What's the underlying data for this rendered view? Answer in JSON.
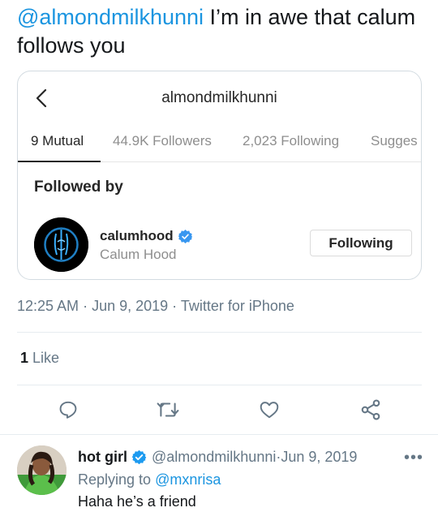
{
  "tweet": {
    "mention": "@almondmilkhunni",
    "text": " I’m in awe that calum follows you"
  },
  "instagram": {
    "username": "almondmilkhunni",
    "tabs": [
      {
        "label": "9 Mutual",
        "active": true
      },
      {
        "label": "44.9K Followers",
        "active": false
      },
      {
        "label": "2,023 Following",
        "active": false
      },
      {
        "label": "Sugges",
        "active": false
      }
    ],
    "section_title": "Followed by",
    "follower": {
      "handle": "calumhood",
      "name": "Calum Hood",
      "verified": true,
      "button_label": "Following"
    }
  },
  "meta": {
    "time": "12:25 AM",
    "date": "Jun 9, 2019",
    "source": "Twitter for iPhone",
    "separator": " · "
  },
  "likes": {
    "count": "1",
    "label": " Like"
  },
  "actions": [
    {
      "icon": "reply-icon"
    },
    {
      "icon": "retweet-icon"
    },
    {
      "icon": "like-icon"
    },
    {
      "icon": "share-icon"
    }
  ],
  "reply": {
    "name": "hot girl",
    "verified": true,
    "handle": "@almondmilkhunni",
    "separator": " · ",
    "date": "Jun 9, 2019",
    "more": "•••",
    "replying_prefix": "Replying to ",
    "replying_to": "@mxnrisa",
    "text": "Haha he’s a friend"
  },
  "colors": {
    "twitter_blue": "#1b95e0",
    "verified_blue": "#1d9bf0",
    "instagram_verified": "#3897f0",
    "secondary_text": "#657786"
  }
}
